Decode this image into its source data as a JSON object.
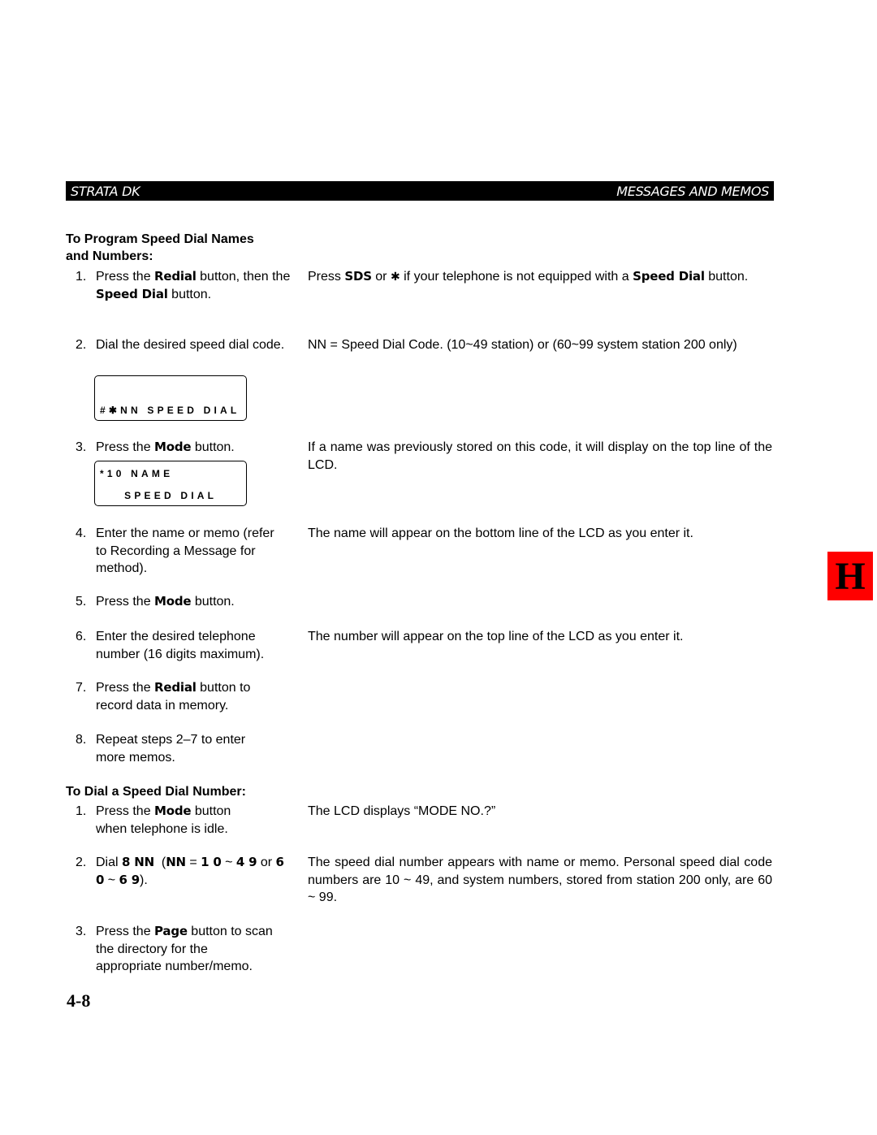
{
  "header": {
    "left": "STRATA DK",
    "right": "MESSAGES AND MEMOS"
  },
  "section1": {
    "heading_line1": "To Program Speed Dial Names",
    "heading_line2": "and Numbers:",
    "steps": [
      {
        "num": "1.",
        "pre": "Press the ",
        "kw1": "Redial",
        "mid": " button, then the ",
        "kw2": "Speed Dial",
        "post": " button."
      },
      {
        "num": "2.",
        "text": "Dial the desired speed dial code."
      },
      {
        "num": "3.",
        "pre": "Press the ",
        "kw1": "Mode",
        "post": " button."
      },
      {
        "num": "4.",
        "text": "Enter the name or memo (refer to Recording a Message for method)."
      },
      {
        "num": "5.",
        "pre": "Press the ",
        "kw1": "Mode",
        "post": " button."
      },
      {
        "num": "6.",
        "text": "Enter the desired telephone number (16 digits maximum)."
      },
      {
        "num": "7.",
        "pre": "Press the ",
        "kw1": "Redial",
        "post": " button to record data in memory."
      },
      {
        "num": "8.",
        "text": "Repeat steps 2–7 to enter more memos."
      }
    ],
    "notes": {
      "step1": {
        "pre": "Press ",
        "kw1": "SDS",
        "mid": " or ",
        "star": "✱",
        "mid2": " if your telephone is not equipped with a ",
        "kw2": "Speed Dial",
        "post": " button."
      },
      "step2": "NN = Speed Dial Code. (10~49 station) or (60~99 system station 200 only)",
      "step3": "If a name was previously stored on this code, it will display on the top line of the LCD.",
      "step4": "The name will appear on the bottom line of the LCD as you enter it.",
      "step6": "The number will appear on the top line of the LCD as you enter it."
    },
    "lcd1": {
      "top": "",
      "bottom": "#✱NN SPEED DIAL"
    },
    "lcd2": {
      "top": "*10 NAME",
      "bottom": "    SPEED DIAL"
    }
  },
  "section2": {
    "heading": "To Dial a Speed Dial Number:",
    "steps": [
      {
        "num": "1.",
        "pre": "Press the ",
        "kw1": "Mode",
        "post": " button when telephone is idle."
      },
      {
        "num": "2.",
        "pre": "Dial ",
        "kw1": "8 NN",
        "mid": "  (",
        "kw2": "NN",
        "mid2": " = ",
        "kw3": "1 0",
        "mid3": " ~ ",
        "kw4": "4 9",
        "mid4": " or ",
        "kw5": "6 0",
        "mid5": " ~ ",
        "kw6": "6 9",
        "post": ")."
      },
      {
        "num": "3.",
        "pre": "Press the ",
        "kw1": "Page",
        "post": " button to scan the directory for the appropriate number/memo."
      }
    ],
    "notes": {
      "step1": "The LCD displays “MODE NO.?”",
      "step2": "The speed dial number appears with name or memo. Personal speed dial code numbers are 10 ~ 49, and system numbers, stored from station 200 only, are 60 ~ 99."
    }
  },
  "side_tab": {
    "label": "H",
    "color": "#ff0000"
  },
  "page_number": "4-8"
}
